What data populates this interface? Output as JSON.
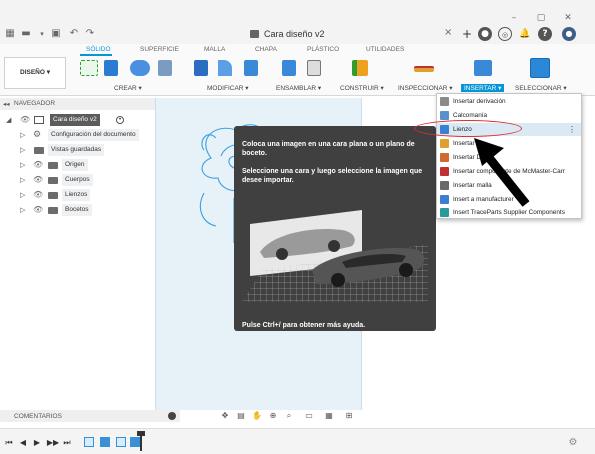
{
  "window": {
    "title": "Cara diseño v2",
    "controls": {
      "minimize": "–",
      "maximize": "▢",
      "close": "✕"
    }
  },
  "title_bar": {
    "left_icons": [
      "apps-grid-icon",
      "file-icon",
      "save-icon",
      "undo-icon",
      "redo-icon"
    ],
    "right_icons": [
      "new-tab-icon",
      "extensions-icon",
      "job-status-icon",
      "notifications-icon",
      "help-icon",
      "user-avatar-icon"
    ],
    "add_tab": "+",
    "close_tab": "×"
  },
  "toolbar": {
    "workspace_button": "DISEÑO ▾",
    "tabs": [
      "SÓLIDO",
      "SUPERFICIE",
      "MALLA",
      "CHAPA",
      "PLÁSTICO",
      "UTILIDADES"
    ],
    "active_tab": "SÓLIDO",
    "groups": [
      "CREAR ▾",
      "MODIFICAR ▾",
      "ENSAMBLAR ▾",
      "CONSTRUIR ▾",
      "INSPECCIONAR ▾",
      "INSERTAR ▾",
      "SELECCIONAR ▾"
    ],
    "active_group": "INSERTAR ▾"
  },
  "navigator": {
    "header": "NAVEGADOR",
    "collapse": "◂◂",
    "items": [
      {
        "label": "Cara diseño v2"
      },
      {
        "label": "Configuración del documento"
      },
      {
        "label": "Vistas guardadas"
      },
      {
        "label": "Origen"
      },
      {
        "label": "Cuerpos"
      },
      {
        "label": "Lienzos"
      },
      {
        "label": "Bocetos"
      }
    ]
  },
  "tooltip": {
    "title": "Coloca una imagen en una cara plana o un plano de boceto.",
    "description": "Seleccione una cara y luego seleccione la imagen que desee importar.",
    "footer": "Pulse Ctrl+/ para obtener más ayuda."
  },
  "insert_menu": {
    "items": [
      {
        "label": "Insertar derivación",
        "color": "#8a8a8a"
      },
      {
        "label": "Calcomanía",
        "color": "#5a8fd0"
      },
      {
        "label": "Lienzo",
        "color": "#3a7fd0"
      },
      {
        "label": "Insertar",
        "color": "#e0a030"
      },
      {
        "label": "Insertar DXF",
        "color": "#d06a30"
      },
      {
        "label": "Insertar componente de McMaster-Carr",
        "color": "#c03030"
      },
      {
        "label": "Insertar malla",
        "color": "#6a6a6a"
      },
      {
        "label": "Insert a manufacturer",
        "color": "#3a7fd0"
      },
      {
        "label": "Insert TraceParts Supplier Components",
        "color": "#2a9a9a"
      }
    ],
    "highlighted": "Lienzo",
    "more": "⋮"
  },
  "comments": {
    "label": "COMENTARIOS"
  },
  "nav_bar_icons": [
    "orbit-icon",
    "look-at-icon",
    "pan-icon",
    "zoom-icon",
    "fit-icon",
    "display-settings-icon",
    "grid-icon",
    "viewports-icon"
  ],
  "timeline": {
    "controls": [
      "⏮",
      "◀",
      "▶",
      "▶▶",
      "⏭"
    ],
    "settings": "⚙"
  },
  "colors": {
    "accent": "#0696d7",
    "tooltip_bg": "#404040",
    "highlight_ellipse": "#e03030"
  }
}
